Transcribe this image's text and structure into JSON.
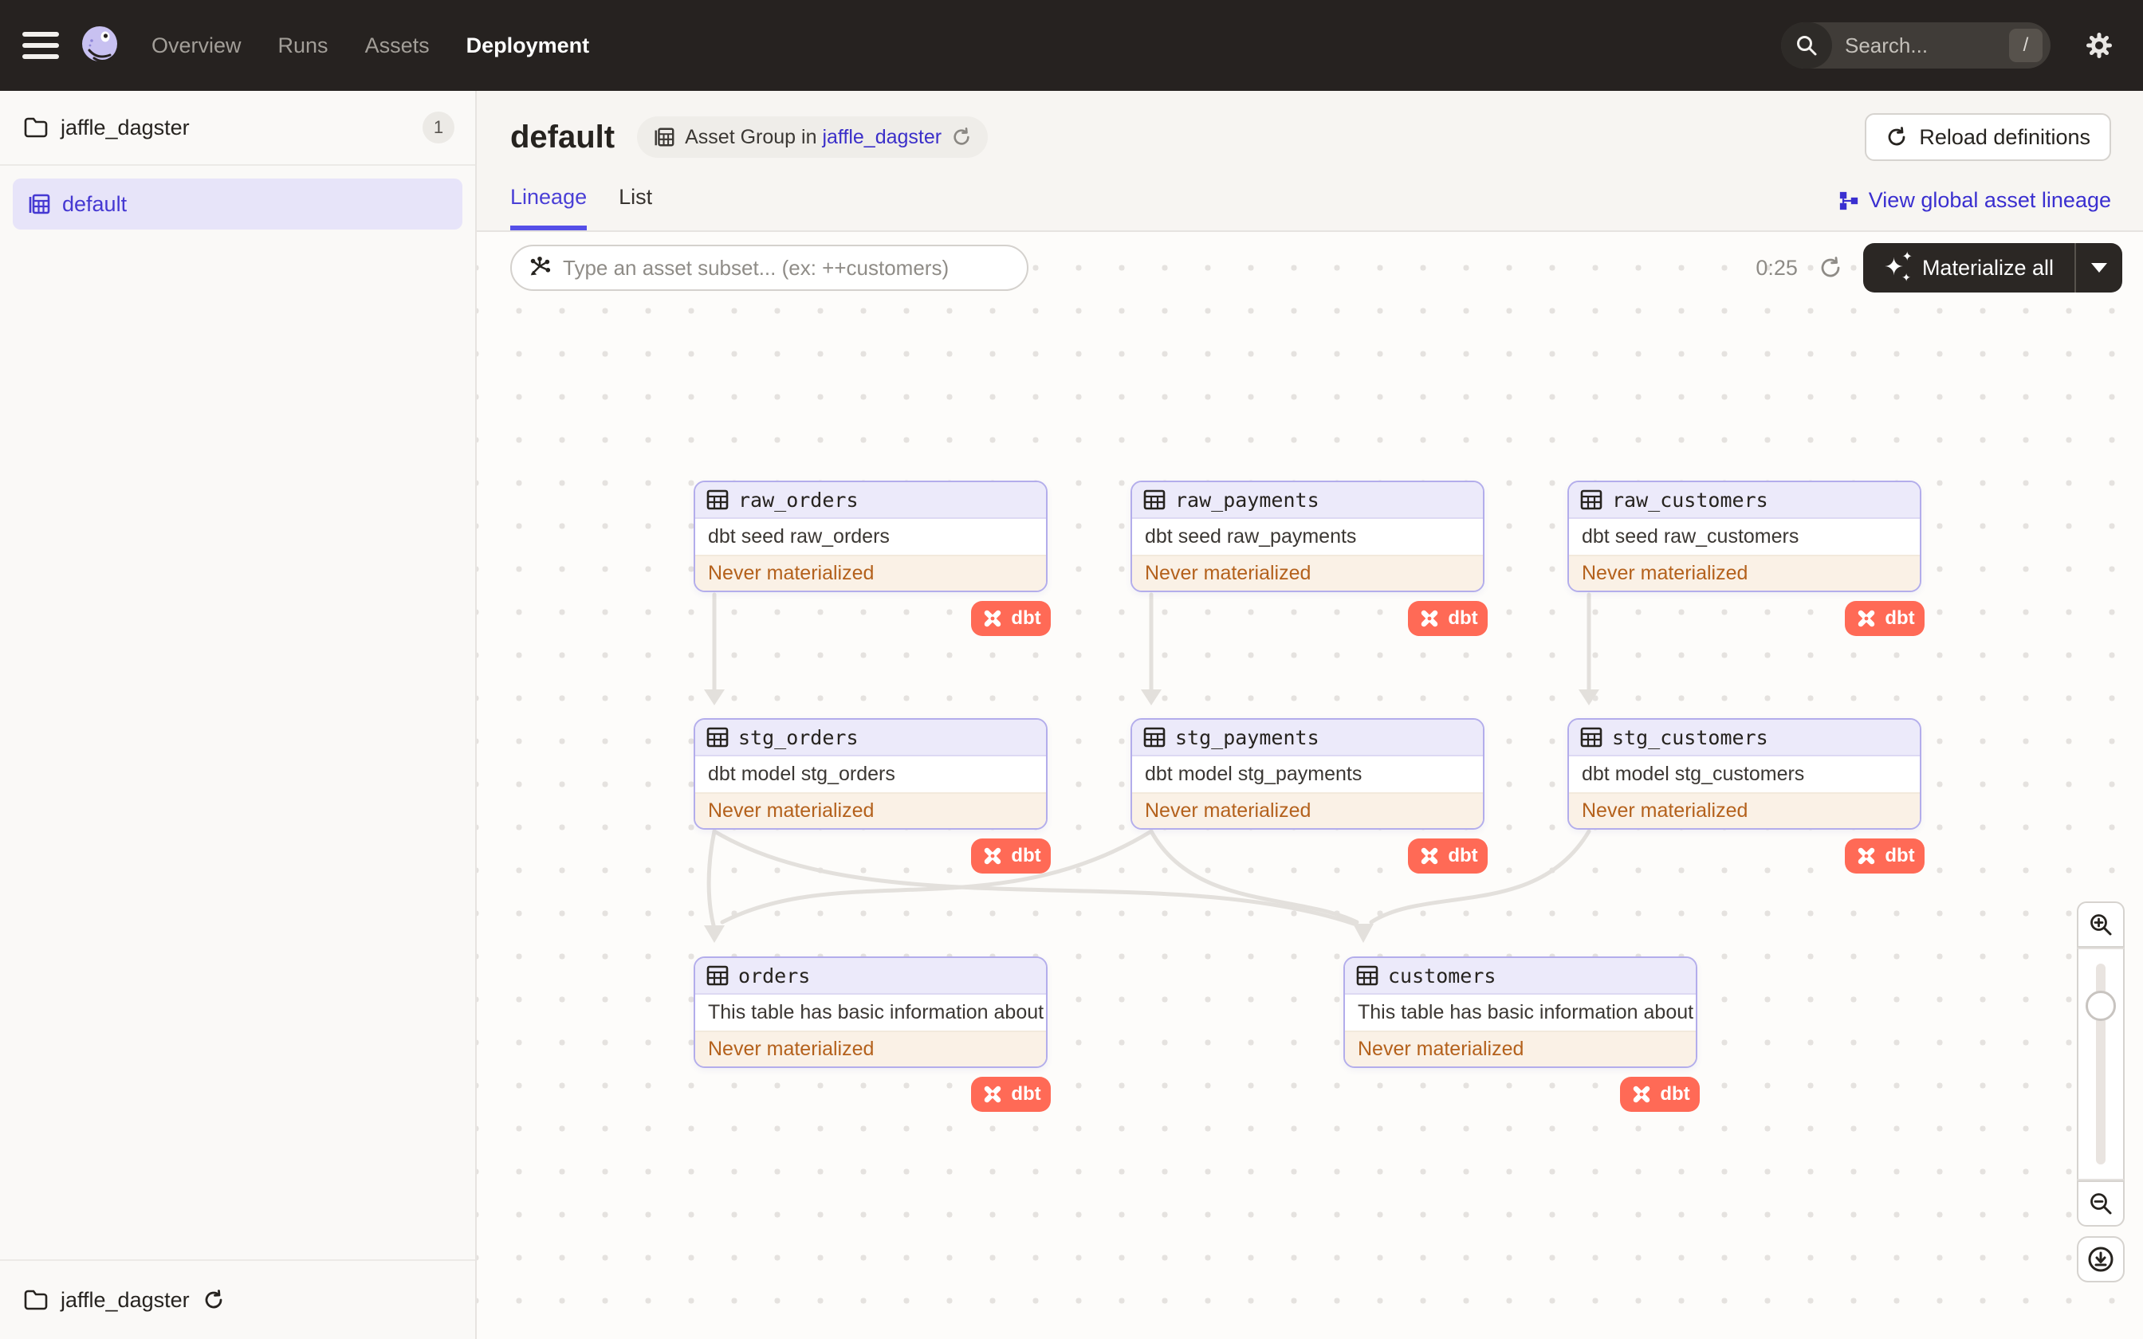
{
  "nav": {
    "items": [
      {
        "label": "Overview",
        "active": false
      },
      {
        "label": "Runs",
        "active": false
      },
      {
        "label": "Assets",
        "active": false
      },
      {
        "label": "Deployment",
        "active": true
      }
    ],
    "search_placeholder": "Search...",
    "search_shortcut": "/"
  },
  "sidebar": {
    "repo_name": "jaffle_dagster",
    "repo_count": "1",
    "selected_group": "default",
    "footer_repo": "jaffle_dagster"
  },
  "header": {
    "title": "default",
    "group_tag_prefix": "Asset Group in",
    "group_tag_link": "jaffle_dagster",
    "reload_button": "Reload definitions",
    "view_global_link": "View global asset lineage"
  },
  "tabs": {
    "lineage": "Lineage",
    "list": "List"
  },
  "toolbar": {
    "subset_placeholder": "Type an asset subset... (ex: ++customers)",
    "timer": "0:25",
    "materialize_button": "Materialize all"
  },
  "nodes": [
    {
      "name": "raw_orders",
      "description": "dbt seed raw_orders",
      "status": "Never materialized",
      "badge": "dbt"
    },
    {
      "name": "raw_payments",
      "description": "dbt seed raw_payments",
      "status": "Never materialized",
      "badge": "dbt"
    },
    {
      "name": "raw_customers",
      "description": "dbt seed raw_customers",
      "status": "Never materialized",
      "badge": "dbt"
    },
    {
      "name": "stg_orders",
      "description": "dbt model stg_orders",
      "status": "Never materialized",
      "badge": "dbt"
    },
    {
      "name": "stg_payments",
      "description": "dbt model stg_payments",
      "status": "Never materialized",
      "badge": "dbt"
    },
    {
      "name": "stg_customers",
      "description": "dbt model stg_customers",
      "status": "Never materialized",
      "badge": "dbt"
    },
    {
      "name": "orders",
      "description": "This table has basic information about ...",
      "status": "Never materialized",
      "badge": "dbt"
    },
    {
      "name": "customers",
      "description": "This table has basic information about ...",
      "status": "Never materialized",
      "badge": "dbt"
    }
  ],
  "colors": {
    "accent_indigo": "#4F43DC",
    "nav_background": "#262220",
    "node_border": "#B3ADEB",
    "node_header_bg": "#ECEAFA",
    "status_bg": "#FAF1E6",
    "status_text": "#B4611C",
    "dbt_badge": "#FF6A56",
    "edge_gray": "#E3E0DC"
  }
}
